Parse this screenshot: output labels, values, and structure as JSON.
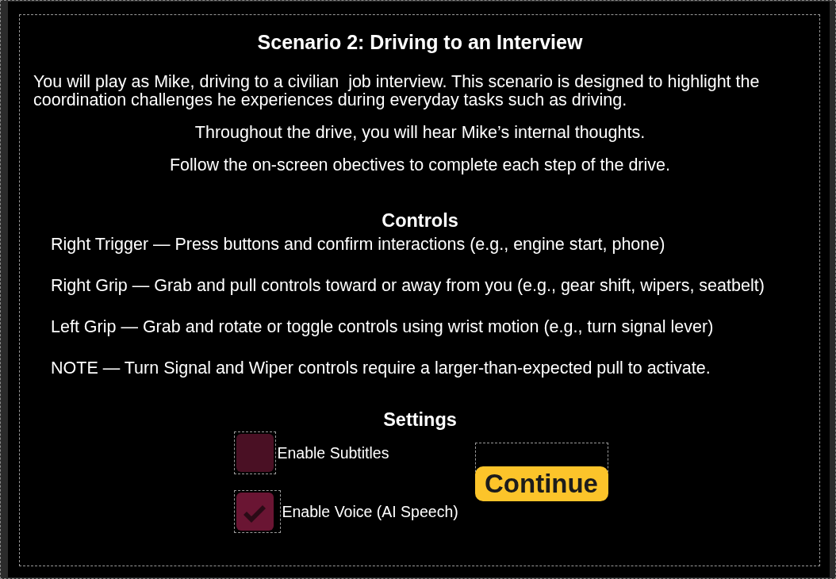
{
  "title": "Scenario 2: Driving to an Interview",
  "description": "You will play as Mike, driving to a civilian  job interview. This scenario is designed to highlight the coordination challenges he experiences during everyday tasks such as driving.",
  "notes": [
    "Throughout the drive, you will hear Mike’s internal thoughts.",
    "Follow the on-screen obectives to complete each step of the drive."
  ],
  "controls": {
    "heading": "Controls",
    "items": [
      "Right Trigger — Press buttons and confirm interactions (e.g., engine start, phone)",
      "Right Grip — Grab and pull controls toward or away from you (e.g., gear shift, wipers, seatbelt)",
      "Left Grip — Grab and rotate or toggle controls using wrist motion (e.g., turn signal lever)",
      "NOTE — Turn Signal and Wiper controls require a larger-than-expected pull to activate."
    ]
  },
  "settings": {
    "heading": "Settings",
    "options": [
      {
        "label": "Enable Subtitles",
        "checked": false
      },
      {
        "label": "Enable Voice (AI Speech)",
        "checked": true
      }
    ]
  },
  "continue_button": {
    "label": "Continue"
  }
}
